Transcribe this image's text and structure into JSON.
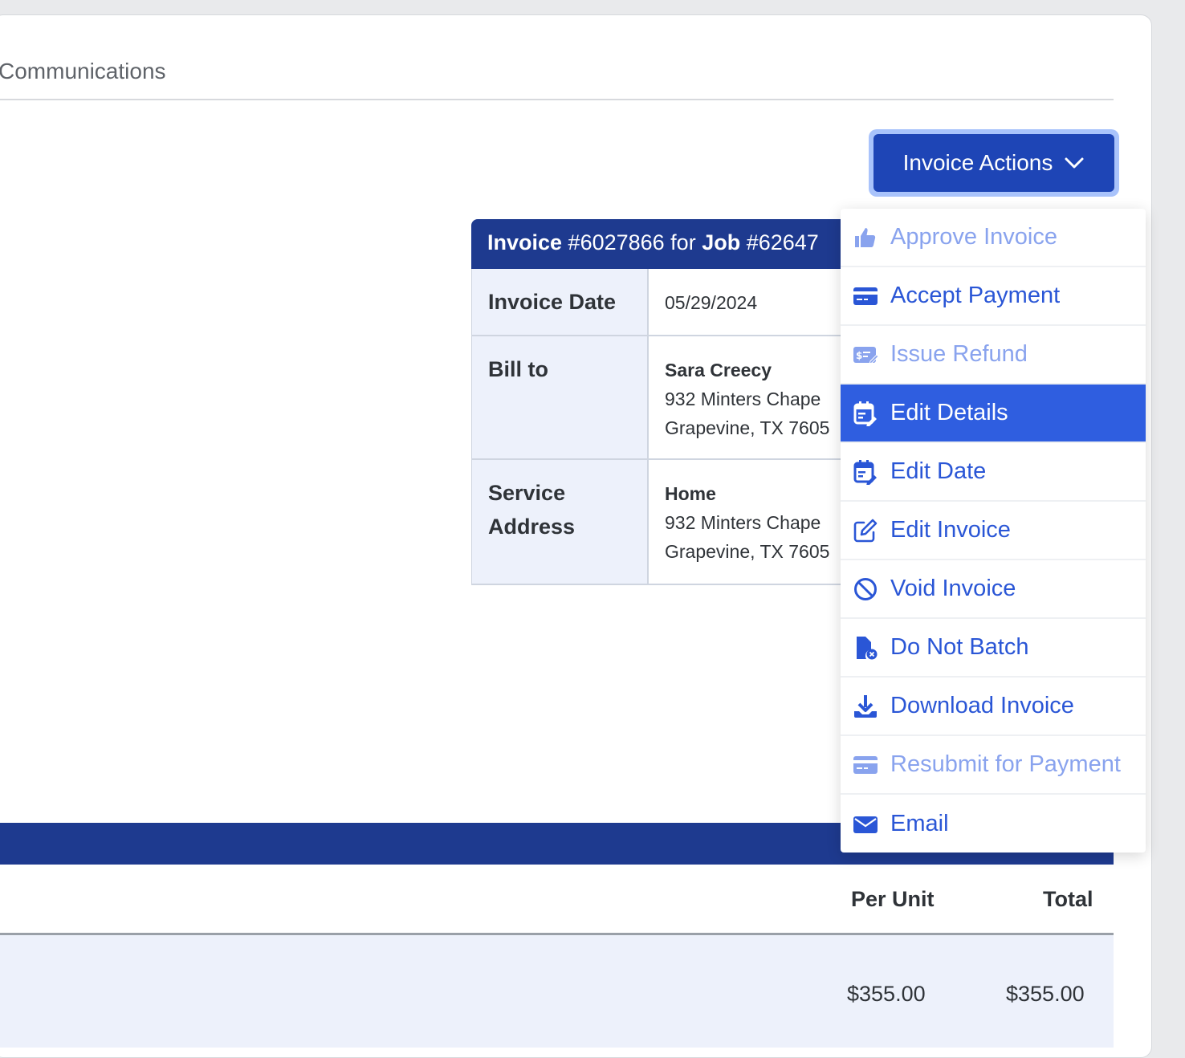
{
  "tabs": {
    "communications": "Communications"
  },
  "actions_button": {
    "label": "Invoice Actions"
  },
  "invoice": {
    "header_prefix_bold": "Invoice",
    "header_number": " #6027866 for ",
    "header_job_bold": "Job",
    "header_job_number": " #62647",
    "invoice_date_label": "Invoice Date",
    "invoice_date_value": "05/29/2024",
    "bill_to_label": "Bill to",
    "bill_to_name": "Sara Creecy",
    "bill_to_line1": "932 Minters Chape",
    "bill_to_line2": "Grapevine, TX 7605",
    "service_label_1": "Service",
    "service_label_2": "Address",
    "service_name": "Home",
    "service_line1": "932 Minters Chape",
    "service_line2": "Grapevine, TX 7605"
  },
  "items_table": {
    "col_per_unit": "Per Unit",
    "col_total": "Total",
    "row_per_unit": "$355.00",
    "row_total": "$355.00"
  },
  "menu": {
    "items": [
      {
        "label": "Approve Invoice",
        "icon": "thumbs-up-icon",
        "state": "disabled"
      },
      {
        "label": "Accept Payment",
        "icon": "credit-card-icon",
        "state": "normal"
      },
      {
        "label": "Issue Refund",
        "icon": "refund-icon",
        "state": "disabled"
      },
      {
        "label": "Edit Details",
        "icon": "calendar-edit-icon",
        "state": "active"
      },
      {
        "label": "Edit Date",
        "icon": "calendar-edit-icon",
        "state": "normal"
      },
      {
        "label": "Edit Invoice",
        "icon": "pencil-square-icon",
        "state": "normal"
      },
      {
        "label": "Void Invoice",
        "icon": "ban-icon",
        "state": "normal"
      },
      {
        "label": "Do Not Batch",
        "icon": "file-x-icon",
        "state": "normal"
      },
      {
        "label": "Download Invoice",
        "icon": "download-icon",
        "state": "normal"
      },
      {
        "label": "Resubmit for Payment",
        "icon": "credit-card-icon",
        "state": "disabled"
      },
      {
        "label": "Email",
        "icon": "envelope-icon",
        "state": "normal"
      }
    ]
  },
  "colors": {
    "primary": "#1e45b6",
    "header_navy": "#1e3a8f",
    "menu_link": "#2a56d6",
    "menu_disabled": "#89a3ee",
    "menu_active_bg": "#2f5ee0",
    "label_bg": "#edf1fb"
  }
}
